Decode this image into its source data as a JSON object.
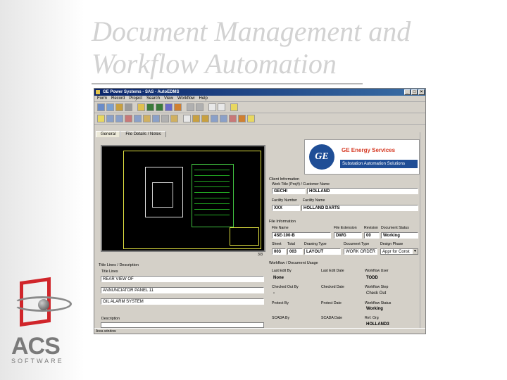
{
  "slide": {
    "title_line1": "Document Management and",
    "title_line2": "Workflow Automation",
    "logo_text": "ACS",
    "logo_sub": "SOFTWARE"
  },
  "window": {
    "title": "GE Power Systems - SAS - AutoEDMS",
    "menu": [
      "Form",
      "Record",
      "Project",
      "Search",
      "View",
      "Workflow",
      "Help"
    ],
    "tabs": [
      "General",
      "File Details / Notes"
    ],
    "status": "Area window",
    "viewer_status": "3/3"
  },
  "ge": {
    "monogram": "GE",
    "title": "GE Energy Services",
    "subtitle": "Substation Automation Solutions"
  },
  "client": {
    "section": "Client Information",
    "work_title_label": "Work Title (Proj#) / Customer Name",
    "work_title_1": "GECHI",
    "work_title_2": "HOLLAND",
    "facility_label": "Facility Number",
    "facility_name_label": "Facility Name",
    "facility_number": "XXX",
    "facility_name": "HOLLAND DARTS"
  },
  "file": {
    "section": "File Information",
    "file_name_label": "File Name",
    "file_ext_label": "File Extension",
    "revision_label": "Revision",
    "doc_status_label": "Document Status",
    "file_name": "4SE-100-B",
    "file_ext": "DWG",
    "revision": "00",
    "doc_status": "Working",
    "sheet_label": "Sheet",
    "total_label": "Total",
    "drawing_type_label": "Drawing Type",
    "doc_type_label": "Document Type",
    "design_phase_label": "Design Phase",
    "sheet": "003",
    "total": "003",
    "drawing_type": "LAYOUT",
    "doc_type": "WORK ORDER",
    "design_phase": "Appr for Const"
  },
  "workflow": {
    "section": "Workflow / Document Usage",
    "last_edit_by_label": "Last Edit By",
    "last_edit_date_label": "Last Edit Date",
    "workflow_user_label": "Workflow User",
    "last_edit_by": "None",
    "workflow_user": "TODD",
    "checked_out_by_label": "Checked Out By",
    "checked_out_date_label": "Checked Date",
    "workflow_step_label": "Workflow Step",
    "checked_out_by": "-",
    "workflow_step": "Check Out",
    "protected_by_label": "Protect By",
    "protect_date_label": "Protect Date",
    "workflow_status_label": "Workflow Status",
    "workflow_status": "Working",
    "scada_by_label": "SCADA By",
    "scada_date_label": "SCADA Date",
    "ref_org_label": "Ref. Org",
    "ref_org": "HOLLAND3"
  },
  "titles": {
    "section": "Title Lines / Description",
    "title_lines_label": "Title Lines",
    "line1": "REAR VIEW OF",
    "line2": "ANNUNCIATOR PANEL 11",
    "line3": "OIL ALARM SYSTEM",
    "description_label": "Description"
  }
}
